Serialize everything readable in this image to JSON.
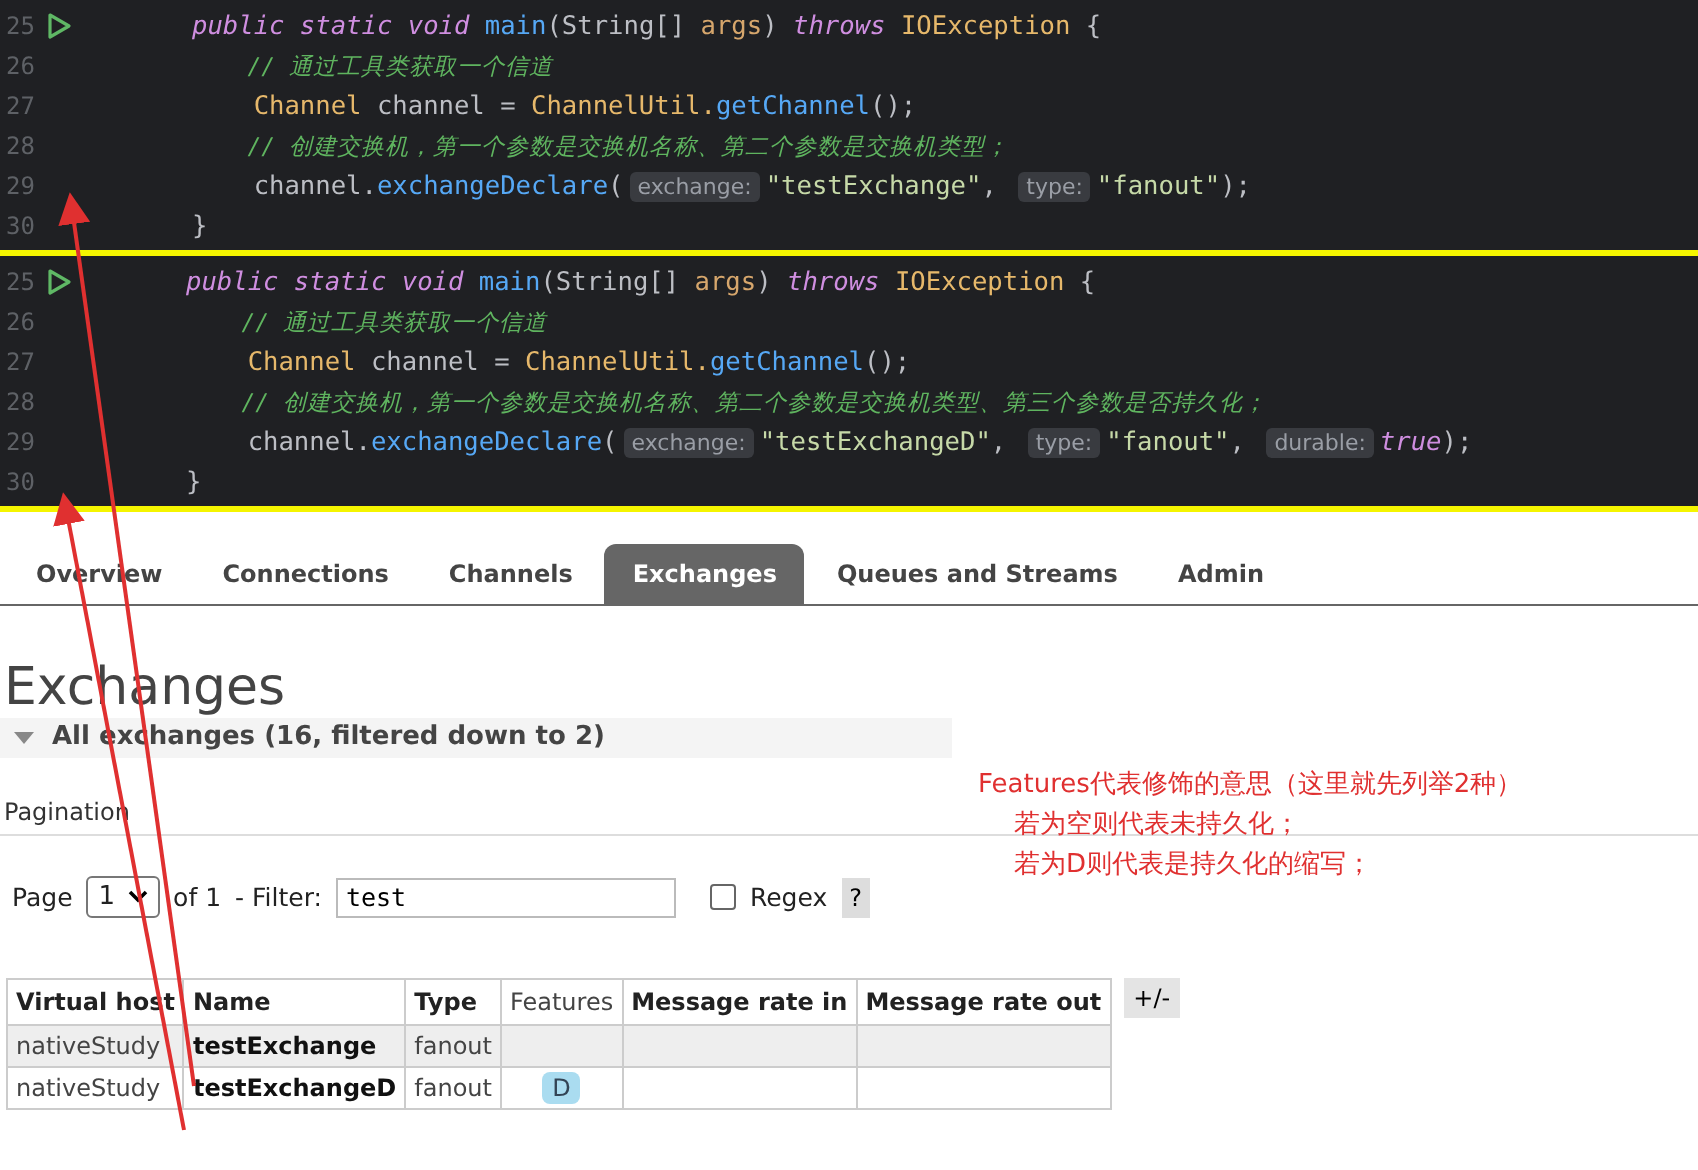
{
  "code_panels": [
    {
      "lines": [
        {
          "number": "25",
          "run_icon": true,
          "tokens": [
            {
              "kind": "keyword",
              "text": "public static void "
            },
            {
              "kind": "func",
              "text": "main"
            },
            {
              "kind": "plain",
              "text": "(String[] "
            },
            {
              "kind": "param",
              "text": "args"
            },
            {
              "kind": "plain",
              "text": ") "
            },
            {
              "kind": "keyword",
              "text": "throws "
            },
            {
              "kind": "type",
              "text": "IOException"
            },
            {
              "kind": "plain",
              "text": " {"
            }
          ]
        },
        {
          "number": "26",
          "run_icon": false,
          "tokens": [
            {
              "kind": "comment",
              "text": "    // 通过工具类获取一个信道"
            }
          ]
        },
        {
          "number": "27",
          "run_icon": false,
          "tokens": [
            {
              "kind": "type",
              "text": "    Channel"
            },
            {
              "kind": "plain",
              "text": " channel = "
            },
            {
              "kind": "type",
              "text": "ChannelUtil."
            },
            {
              "kind": "method",
              "text": "getChannel"
            },
            {
              "kind": "plain",
              "text": "();"
            }
          ]
        },
        {
          "number": "28",
          "run_icon": false,
          "tokens": [
            {
              "kind": "comment",
              "text": "    // 创建交换机，第一个参数是交换机名称、第二个参数是交换机类型；"
            }
          ]
        },
        {
          "number": "29",
          "run_icon": false,
          "tokens": [
            {
              "kind": "plain",
              "text": "    channel."
            },
            {
              "kind": "method",
              "text": "exchangeDeclare"
            },
            {
              "kind": "plain",
              "text": "("
            },
            {
              "kind": "hint",
              "text": "exchange:"
            },
            {
              "kind": "string",
              "text": "\"testExchange\""
            },
            {
              "kind": "plain",
              "text": ", "
            },
            {
              "kind": "hint",
              "text": "type:"
            },
            {
              "kind": "string",
              "text": "\"fanout\""
            },
            {
              "kind": "plain",
              "text": ");"
            }
          ]
        },
        {
          "number": "30",
          "run_icon": false,
          "tokens": [
            {
              "kind": "plain",
              "text": "}"
            }
          ]
        }
      ]
    },
    {
      "lines": [
        {
          "number": "25",
          "run_icon": true,
          "tokens": [
            {
              "kind": "keyword",
              "text": "public static void "
            },
            {
              "kind": "func",
              "text": "main"
            },
            {
              "kind": "plain",
              "text": "(String[] "
            },
            {
              "kind": "param",
              "text": "args"
            },
            {
              "kind": "plain",
              "text": ") "
            },
            {
              "kind": "keyword",
              "text": "throws "
            },
            {
              "kind": "type",
              "text": "IOException"
            },
            {
              "kind": "plain",
              "text": " {"
            }
          ]
        },
        {
          "number": "26",
          "run_icon": false,
          "tokens": [
            {
              "kind": "comment",
              "text": "    // 通过工具类获取一个信道"
            }
          ]
        },
        {
          "number": "27",
          "run_icon": false,
          "tokens": [
            {
              "kind": "type",
              "text": "    Channel"
            },
            {
              "kind": "plain",
              "text": " channel = "
            },
            {
              "kind": "type",
              "text": "ChannelUtil."
            },
            {
              "kind": "method",
              "text": "getChannel"
            },
            {
              "kind": "plain",
              "text": "();"
            }
          ]
        },
        {
          "number": "28",
          "run_icon": false,
          "tokens": [
            {
              "kind": "comment",
              "text": "    // 创建交换机，第一个参数是交换机名称、第二个参数是交换机类型、第三个参数是否持久化；"
            }
          ]
        },
        {
          "number": "29",
          "run_icon": false,
          "tokens": [
            {
              "kind": "plain",
              "text": "    channel."
            },
            {
              "kind": "method",
              "text": "exchangeDeclare"
            },
            {
              "kind": "plain",
              "text": "("
            },
            {
              "kind": "hint",
              "text": "exchange:"
            },
            {
              "kind": "string",
              "text": "\"testExchangeD\""
            },
            {
              "kind": "plain",
              "text": ", "
            },
            {
              "kind": "hint",
              "text": "type:"
            },
            {
              "kind": "string",
              "text": "\"fanout\""
            },
            {
              "kind": "plain",
              "text": ", "
            },
            {
              "kind": "hint",
              "text": "durable:"
            },
            {
              "kind": "keyword",
              "text": "true"
            },
            {
              "kind": "plain",
              "text": ");"
            }
          ]
        },
        {
          "number": "30",
          "run_icon": false,
          "tokens": [
            {
              "kind": "plain",
              "text": "}"
            }
          ]
        }
      ]
    }
  ],
  "tabs": [
    {
      "label": "Overview",
      "selected": false
    },
    {
      "label": "Connections",
      "selected": false
    },
    {
      "label": "Channels",
      "selected": false
    },
    {
      "label": "Exchanges",
      "selected": true
    },
    {
      "label": "Queues and Streams",
      "selected": false
    },
    {
      "label": "Admin",
      "selected": false
    }
  ],
  "heading": "Exchanges",
  "section": {
    "title": "All exchanges (16, filtered down to 2)",
    "expanded": true
  },
  "pagination_label": "Pagination",
  "pager": {
    "page_label": "Page",
    "page": "1",
    "of": "of 1",
    "filter_label": "- Filter:",
    "filter_value": "test",
    "regex_label": "Regex",
    "regex_checked": false,
    "help": "?"
  },
  "table": {
    "columns": [
      {
        "label": "Virtual host",
        "bold": true
      },
      {
        "label": "Name",
        "bold": true
      },
      {
        "label": "Type",
        "bold": true
      },
      {
        "label": "Features",
        "bold": false
      },
      {
        "label": "Message rate in",
        "bold": true
      },
      {
        "label": "Message rate out",
        "bold": true
      }
    ],
    "toggle": "+/-",
    "rows": [
      {
        "vhost": "nativeStudy",
        "name": "testExchange",
        "type": "fanout"
      },
      {
        "vhost": "nativeStudy",
        "name": "testExchangeD",
        "type": "fanout",
        "features": [
          "D"
        ]
      }
    ]
  },
  "annotation": [
    "Features代表修饰的意思（这里就先列举2种）",
    "若为空则代表未持久化；",
    "若为D则代表是持久化的缩写；"
  ]
}
